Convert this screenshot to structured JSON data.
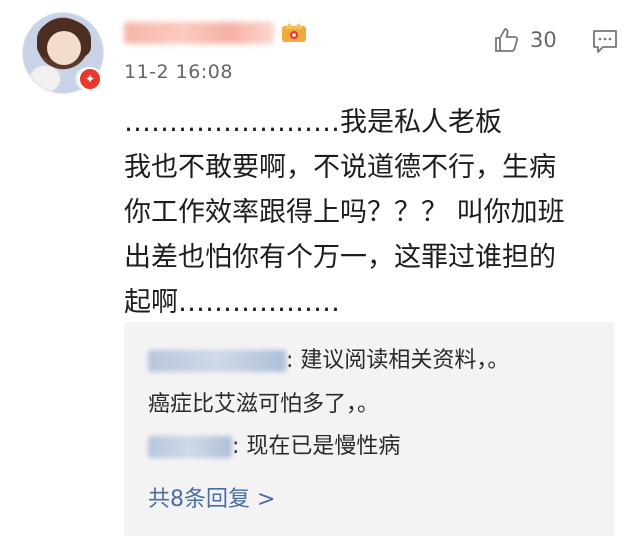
{
  "comment": {
    "timestamp": "11-2 16:08",
    "like_count": "30",
    "body_lines": [
      "……………………我是私人老板",
      "我也不敢要啊，不说道德不行，生病",
      "你工作效率跟得上吗？？？ 叫你加班",
      "出差也怕你有个万一，这罪过谁担的",
      "起啊………………"
    ]
  },
  "replies": [
    {
      "text": ": 建议阅读相关资料，。"
    },
    {
      "text": "癌症比艾滋可怕多了，。"
    },
    {
      "text": ": 现在已是慢性病"
    }
  ],
  "more_replies_label": "共8条回复 >",
  "icons": {
    "like": "thumbs-up-icon",
    "comment": "comment-icon",
    "verified": "verified-badge-icon",
    "crown": "crown-icon"
  },
  "colors": {
    "link": "#4a6da7",
    "reply_bg": "#f3f3f3",
    "badge": "#e8392c"
  }
}
